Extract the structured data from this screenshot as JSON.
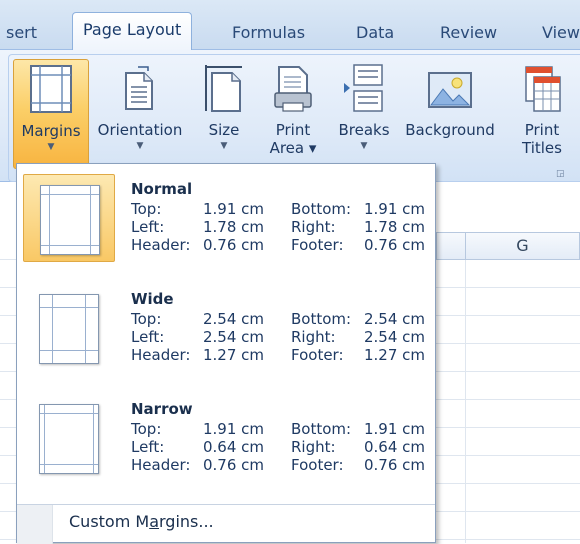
{
  "tabs": [
    {
      "label": "sert",
      "active": false
    },
    {
      "label": "Page Layout",
      "active": true
    },
    {
      "label": "Formulas",
      "active": false
    },
    {
      "label": "Data",
      "active": false
    },
    {
      "label": "Review",
      "active": false
    },
    {
      "label": "View",
      "active": false
    }
  ],
  "ribbon": {
    "margins": {
      "label": "Margins",
      "icon": "margins-icon"
    },
    "orientation": {
      "label": "Orientation",
      "icon": "orientation-icon"
    },
    "size": {
      "label": "Size",
      "icon": "page-size-icon"
    },
    "print_area": {
      "label_line1": "Print",
      "label_line2": "Area ▾",
      "icon": "print-area-icon"
    },
    "breaks": {
      "label": "Breaks",
      "icon": "breaks-icon"
    },
    "background": {
      "label": "Background",
      "icon": "background-icon"
    },
    "print_titles": {
      "label_line1": "Print",
      "label_line2": "Titles",
      "icon": "print-titles-icon"
    }
  },
  "sheet": {
    "column_g": "G"
  },
  "margins_menu": {
    "options": [
      {
        "name": "Normal",
        "selected": true,
        "top_label": "Top:",
        "top": "1.91 cm",
        "bottom_label": "Bottom:",
        "bottom": "1.91 cm",
        "left_label": "Left:",
        "left": "1.78 cm",
        "right_label": "Right:",
        "right": "1.78 cm",
        "header_label": "Header:",
        "header": "0.76 cm",
        "footer_label": "Footer:",
        "footer": "0.76 cm"
      },
      {
        "name": "Wide",
        "selected": false,
        "top_label": "Top:",
        "top": "2.54 cm",
        "bottom_label": "Bottom:",
        "bottom": "2.54 cm",
        "left_label": "Left:",
        "left": "2.54 cm",
        "right_label": "Right:",
        "right": "2.54 cm",
        "header_label": "Header:",
        "header": "1.27 cm",
        "footer_label": "Footer:",
        "footer": "1.27 cm"
      },
      {
        "name": "Narrow",
        "selected": false,
        "top_label": "Top:",
        "top": "1.91 cm",
        "bottom_label": "Bottom:",
        "bottom": "1.91 cm",
        "left_label": "Left:",
        "left": "0.64 cm",
        "right_label": "Right:",
        "right": "0.64 cm",
        "header_label": "Header:",
        "header": "0.76 cm",
        "footer_label": "Footer:",
        "footer": "0.76 cm"
      }
    ],
    "custom_pre": "Custom M",
    "custom_accel": "a",
    "custom_post": "rgins..."
  },
  "colors": {
    "accent_selected": "#f9c865",
    "ribbon": "#dfeaf8",
    "text": "#1f3a63"
  }
}
